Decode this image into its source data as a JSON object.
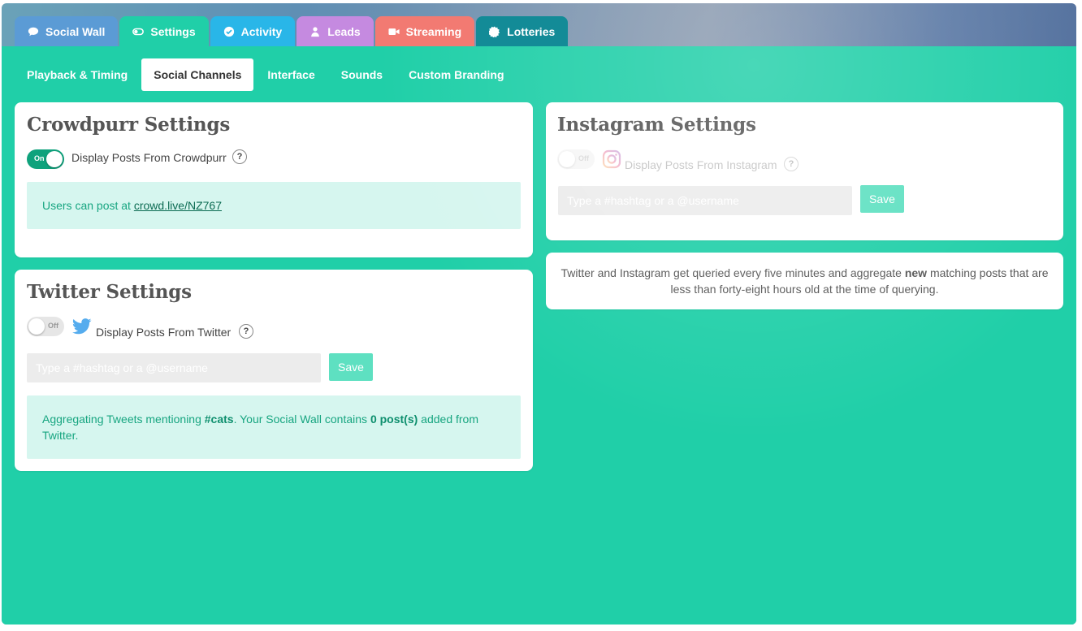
{
  "top_tabs": [
    {
      "label": "Social Wall",
      "icon": "speech-bubble-icon",
      "color": "#5b9bd5"
    },
    {
      "label": "Settings",
      "icon": "toggle-icon",
      "color": "#20cfa8"
    },
    {
      "label": "Activity",
      "icon": "check-circle-icon",
      "color": "#29b6e8"
    },
    {
      "label": "Leads",
      "icon": "person-icon",
      "color": "#c58ae0"
    },
    {
      "label": "Streaming",
      "icon": "video-camera-icon",
      "color": "#f27a72"
    },
    {
      "label": "Lotteries",
      "icon": "gear-icon",
      "color": "#138b97"
    }
  ],
  "sub_tabs": [
    {
      "label": "Playback & Timing"
    },
    {
      "label": "Social Channels",
      "active": true
    },
    {
      "label": "Interface"
    },
    {
      "label": "Sounds"
    },
    {
      "label": "Custom Branding"
    }
  ],
  "crowdpurr": {
    "title": "Crowdpurr Settings",
    "toggle_state": "On",
    "option_label": "Display Posts From Crowdpurr",
    "help": "?",
    "info_prefix": "Users can post at ",
    "info_link": "crowd.live/NZ767"
  },
  "twitter": {
    "title": "Twitter Settings",
    "toggle_state": "Off",
    "option_label": "Display Posts From Twitter",
    "help": "?",
    "input_placeholder": "Type a #hashtag or a @username",
    "save_label": "Save",
    "info_part1": "Aggregating Tweets mentioning ",
    "info_hashtag": "#cats",
    "info_part2": ". Your Social Wall contains ",
    "info_count": "0 post(s)",
    "info_part3": " added from Twitter."
  },
  "instagram": {
    "title": "Instagram Settings",
    "toggle_state": "Off",
    "option_label": "Display Posts From Instagram",
    "help": "?",
    "input_placeholder": "Type a #hashtag or a @username",
    "save_label": "Save"
  },
  "query_note": {
    "part1": "Twitter and Instagram get queried every five minutes and aggregate ",
    "bold": "new",
    "part2": " matching posts that are less than forty-eight hours old at the time of querying."
  },
  "colors": {
    "accent": "#20cfa8",
    "toggle_on": "#0fa27c",
    "info_bg": "#d6f6ef",
    "twitter_blue": "#55acee"
  }
}
